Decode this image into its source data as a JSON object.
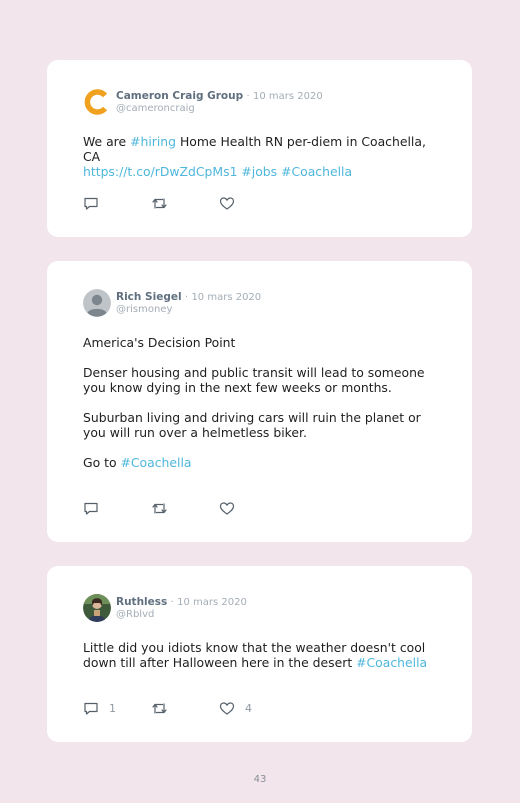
{
  "tweets": [
    {
      "author": "Cameron Craig Group",
      "separator": "·",
      "date": "10 mars 2020",
      "handle": "@cameroncraig",
      "avatar_letter": "C",
      "text": {
        "t1": "We are ",
        "h1": "#hiring",
        "t2": " Home Health RN per-diem in Coachella, CA",
        "link": "https://t.co/rDwZdCpMs1",
        "h2": "#jobs",
        "h3": "#Coachella"
      },
      "reply_count": "",
      "like_count": ""
    },
    {
      "author": "Rich Siegel",
      "separator": "·",
      "date": "10 mars 2020",
      "handle": "@rismoney",
      "text": {
        "p1": "America's Decision Point",
        "p2": "Denser housing and public transit will lead to someone you know dying in the next few weeks or months.",
        "p3": "Suburban living and driving cars will ruin the planet or you will run over a helmetless biker.",
        "p4": "Go to ",
        "h1": "#Coachella"
      },
      "reply_count": "",
      "like_count": ""
    },
    {
      "author": "Ruthless",
      "separator": "·",
      "date": "10 mars 2020",
      "handle": "@Rblvd",
      "text": {
        "t1": "Little did you idiots know that the weather doesn't cool down till after Halloween here in the desert ",
        "h1": "#Coachella"
      },
      "reply_count": "1",
      "like_count": "4"
    }
  ],
  "icons": {
    "reply": "reply-icon",
    "retweet": "retweet-icon",
    "like": "heart-icon"
  },
  "colors": {
    "background": "#f2e5ec",
    "card": "#ffffff",
    "hashtag": "#4fb7dc",
    "author": "#5f6f7f",
    "logo": "#f0a21f"
  },
  "page_number": "43"
}
